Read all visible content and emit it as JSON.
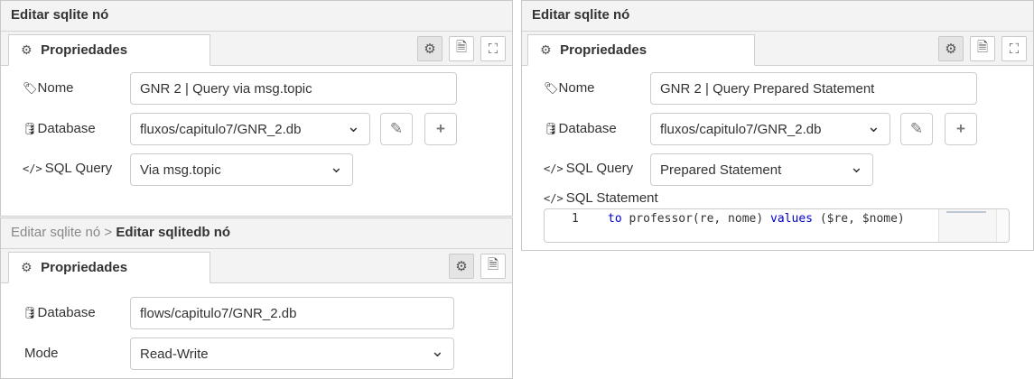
{
  "panel_left": {
    "title": "Editar sqlite nó",
    "tab_label": "Propriedades",
    "nome_label": "Nome",
    "nome_value": "GNR 2 | Query via msg.topic",
    "database_label": "Database",
    "database_value": "fluxos/capitulo7/GNR_2.db",
    "sqlquery_label": "SQL Query",
    "sqlquery_value": "Via msg.topic"
  },
  "panel_right": {
    "title": "Editar sqlite nó",
    "tab_label": "Propriedades",
    "nome_label": "Nome",
    "nome_value": "GNR 2 | Query Prepared Statement",
    "database_label": "Database",
    "database_value": "fluxos/capitulo7/GNR_2.db",
    "sqlquery_label": "SQL Query",
    "sqlquery_value": "Prepared Statement",
    "sqlstatement_label": "SQL Statement",
    "editor": {
      "line_number": "1",
      "code_kw1": "to",
      "code_fn": " professor(re, nome) ",
      "code_kw2": "values",
      "code_rest": " ($re, $nome)"
    }
  },
  "panel_bottom": {
    "breadcrumb_parent": "Editar sqlite nó",
    "breadcrumb_separator": " > ",
    "title": "Editar sqlitedb nó",
    "tab_label": "Propriedades",
    "database_label": "Database",
    "database_value": "flows/capitulo7/GNR_2.db",
    "mode_label": "Mode",
    "mode_value": "Read-Write"
  },
  "icons": {
    "gear": "gear-icon",
    "document": "document-icon",
    "expand": "expand-icon",
    "tag": "tag-icon",
    "database": "database-icon",
    "code": "code-icon",
    "pencil": "pencil-icon",
    "plus": "plus-icon"
  }
}
